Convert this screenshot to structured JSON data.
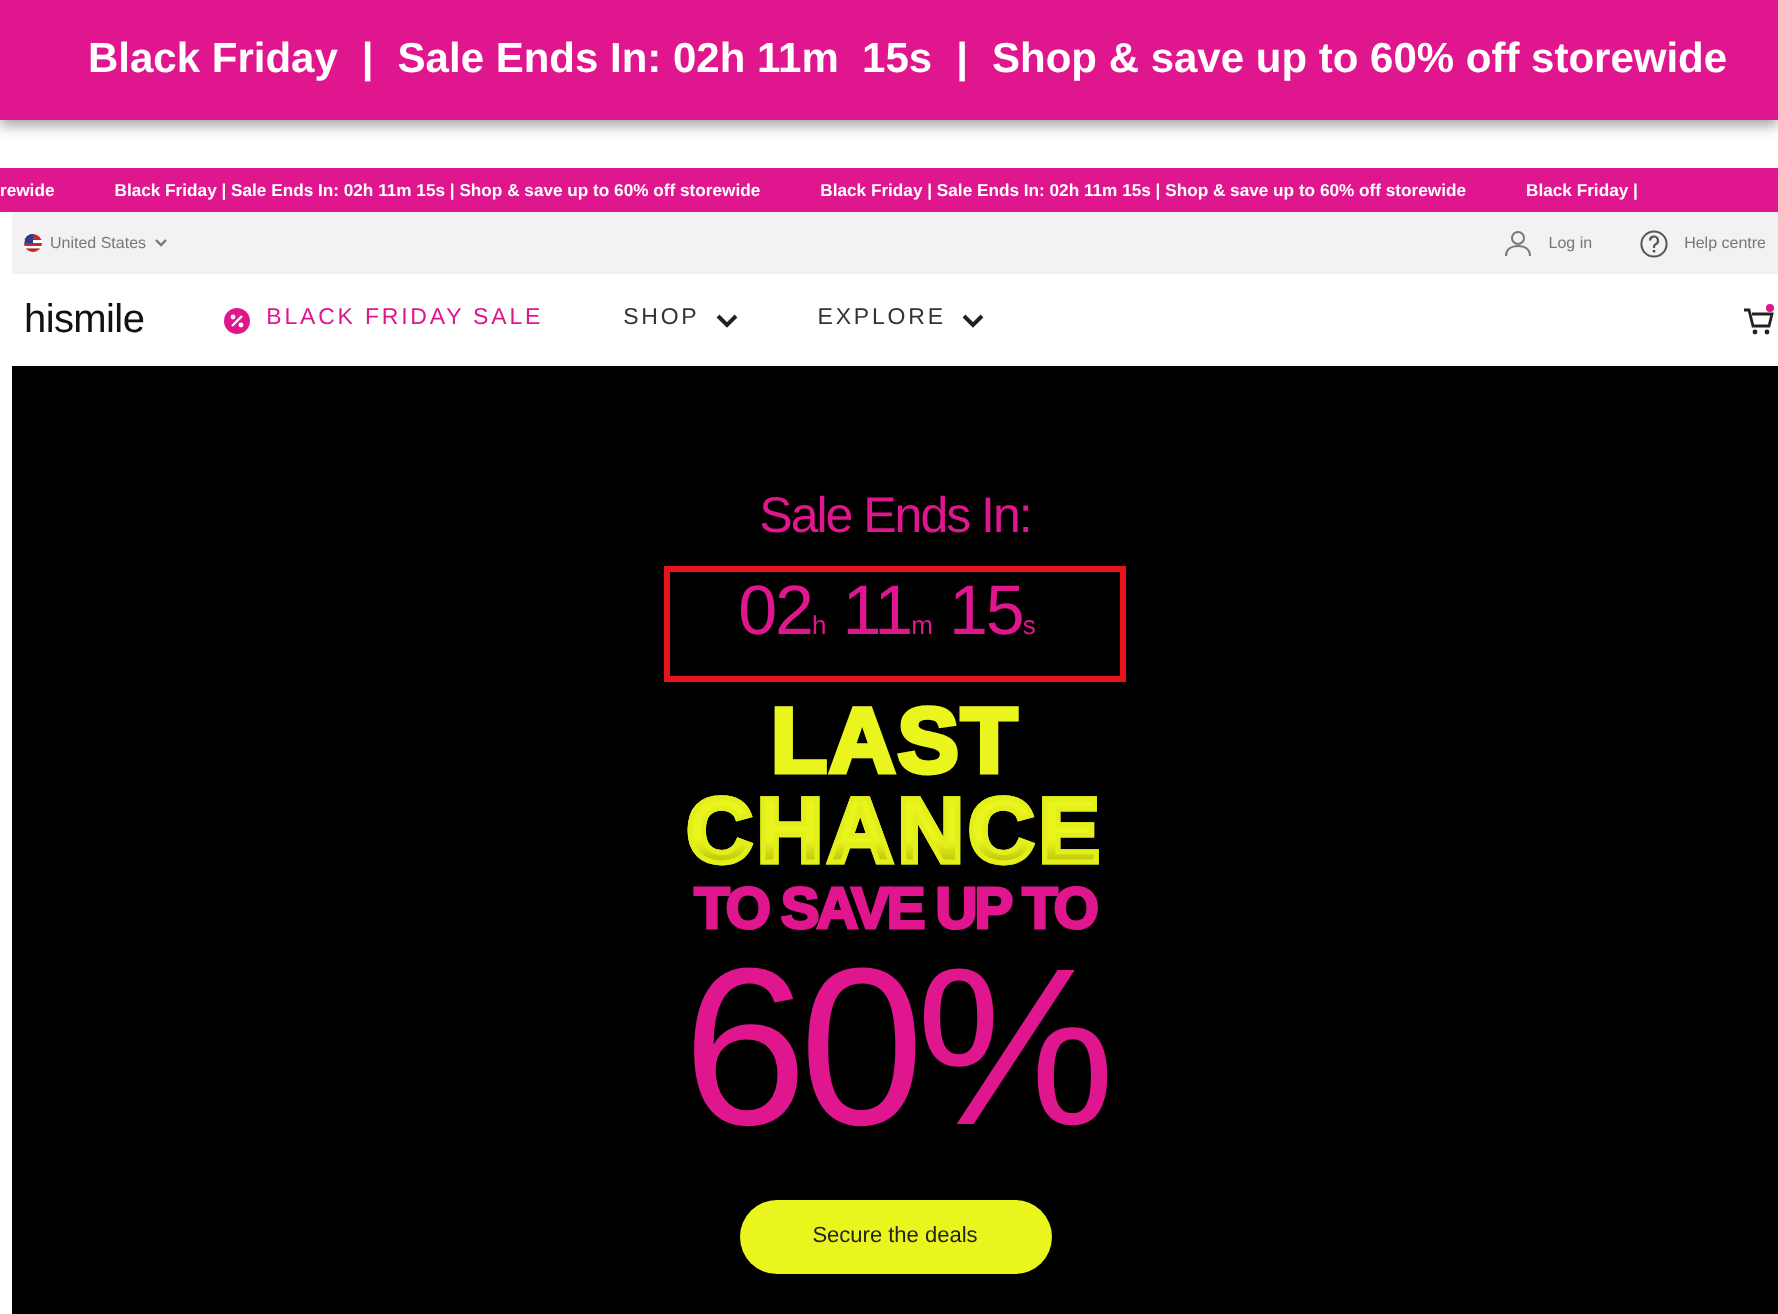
{
  "banner": {
    "parts": [
      "Black Friday",
      "|",
      "Sale Ends In: 02h 11m  15s",
      "|",
      "Shop & save up to 60% off storewide"
    ]
  },
  "ticker": [
    "rewide",
    "Black Friday | Sale Ends In: 02h 11m 15s | Shop & save up to 60% off storewide",
    "Black Friday | Sale Ends In: 02h 11m 15s | Shop & save up to 60% off storewide",
    "Black Friday |"
  ],
  "utility_bar": {
    "country": "United States",
    "links": [
      {
        "label": "Log in",
        "kind": "account"
      },
      {
        "label": "Help centre",
        "kind": "help"
      }
    ]
  },
  "nav": {
    "logo": "hismile",
    "items": [
      {
        "label": "BLACK FRIDAY SALE",
        "kind": "promo"
      },
      {
        "label": "SHOP",
        "kind": "dropdown"
      },
      {
        "label": "EXPLORE",
        "kind": "dropdown"
      }
    ]
  },
  "hero": {
    "heading": "Sale Ends In:",
    "countdown": [
      {
        "value": "02",
        "unit": "h"
      },
      {
        "value": "11",
        "unit": "m"
      },
      {
        "value": "15",
        "unit": "s"
      }
    ],
    "countdown_highlighted": true,
    "title_lines": [
      "LAST",
      "CHANCE"
    ],
    "subtitle": "TO SAVE UP TO",
    "big_figure": "60%",
    "button": "Secure the deals"
  }
}
